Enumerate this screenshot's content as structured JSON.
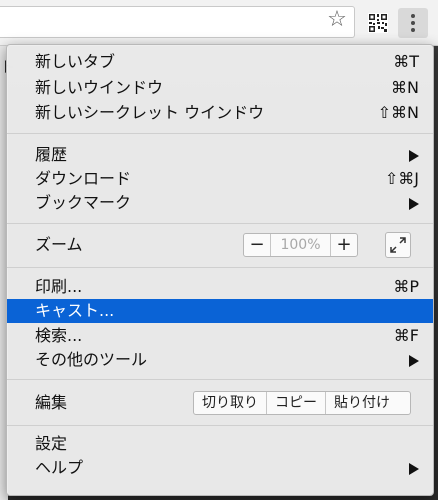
{
  "menu": {
    "new_tab": {
      "label": "新しいタブ",
      "shortcut": "⌘T"
    },
    "new_window": {
      "label": "新しいウインドウ",
      "shortcut": "⌘N"
    },
    "new_incognito": {
      "label": "新しいシークレット ウインドウ",
      "shortcut": "⇧⌘N"
    },
    "history": {
      "label": "履歴"
    },
    "downloads": {
      "label": "ダウンロード",
      "shortcut": "⇧⌘J"
    },
    "bookmarks": {
      "label": "ブックマーク"
    },
    "zoom": {
      "label": "ズーム",
      "minus": "−",
      "level": "100%",
      "plus": "+"
    },
    "print": {
      "label": "印刷...",
      "shortcut": "⌘P"
    },
    "cast": {
      "label": "キャスト..."
    },
    "find": {
      "label": "検索...",
      "shortcut": "⌘F"
    },
    "more_tools": {
      "label": "その他のツール"
    },
    "edit": {
      "label": "編集",
      "cut": "切り取り",
      "copy": "コピー",
      "paste": "貼り付け"
    },
    "settings": {
      "label": "設定"
    },
    "help": {
      "label": "ヘルプ"
    }
  },
  "page_edge_text": "ト",
  "colors": {
    "highlight": "#0a63d6",
    "menu_bg": "#eeeeee"
  }
}
